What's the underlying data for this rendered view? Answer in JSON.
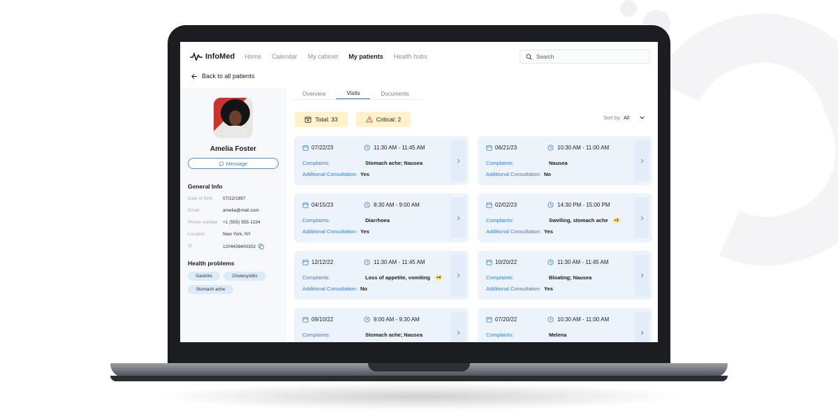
{
  "header": {
    "logo": "InfoMed",
    "nav": [
      "Home",
      "Calendar",
      "My cabinet",
      "My patients",
      "Health hubs"
    ],
    "active_nav": "My patients",
    "search_placeholder": "Search"
  },
  "back_link": "Back to all patients",
  "patient": {
    "name": "Amelia Foster",
    "message_button": "Message",
    "general_info_title": "General Info",
    "info": [
      {
        "label": "Date of birth",
        "value": "07/22/1997"
      },
      {
        "label": "Email",
        "value": "amelia@mail.com"
      },
      {
        "label": "Phone number",
        "value": "+1 (555) 555-1234"
      },
      {
        "label": "Location",
        "value": "New York, NY"
      },
      {
        "label": "ID",
        "value": "1204439400302"
      }
    ],
    "health_problems_title": "Health problems",
    "health_problems": [
      "Gastritis",
      "Cholecystitis",
      "Stomach ache"
    ]
  },
  "tabs": [
    "Overview",
    "Visits",
    "Documents"
  ],
  "active_tab": "Visits",
  "stats": {
    "total": "Total: 33",
    "critical": "Critical: 2"
  },
  "sort": {
    "label": "Sort by:",
    "value": "All"
  },
  "visit_labels": {
    "complaints": "Complaints:",
    "additional": "Additional Consultation:"
  },
  "visits": [
    {
      "date": "07/22/23",
      "time": "11:30 AM - 11:45 AM",
      "complaints": "Stomach ache; Nausea",
      "badge": "",
      "additional": "Yes"
    },
    {
      "date": "06/21/23",
      "time": "10:30 AM - 11:00 AM",
      "complaints": "Nausea",
      "badge": "",
      "additional": "No"
    },
    {
      "date": "04/15/23",
      "time": "8:30 AM - 9:00 AM",
      "complaints": "Diarrhoea",
      "badge": "",
      "additional": "Yes"
    },
    {
      "date": "02/02/23",
      "time": "14:30 PM - 15:00 PM",
      "complaints": "Swelling, stomach ache",
      "badge": "+3",
      "additional": "Yes"
    },
    {
      "date": "12/12/22",
      "time": "11:30 AM - 11:45 AM",
      "complaints": "Loss of appetite, vomiting",
      "badge": "+4",
      "additional": "No"
    },
    {
      "date": "10/20/22",
      "time": "11:30 AM - 11:45 AM",
      "complaints": "Bloating; Nausea",
      "badge": "",
      "additional": "Yes"
    },
    {
      "date": "09/10/22",
      "time": "9:00 AM - 9:30 AM",
      "complaints": "Stomach ache; Nausea",
      "badge": "",
      "additional": ""
    },
    {
      "date": "07/20/22",
      "time": "10:30 AM - 11:00 AM",
      "complaints": "Melena",
      "badge": "",
      "additional": ""
    }
  ],
  "colors": {
    "accent": "#3a7cc9",
    "card_bg": "#edf3fb",
    "stat_bg": "#fdf2c9"
  }
}
